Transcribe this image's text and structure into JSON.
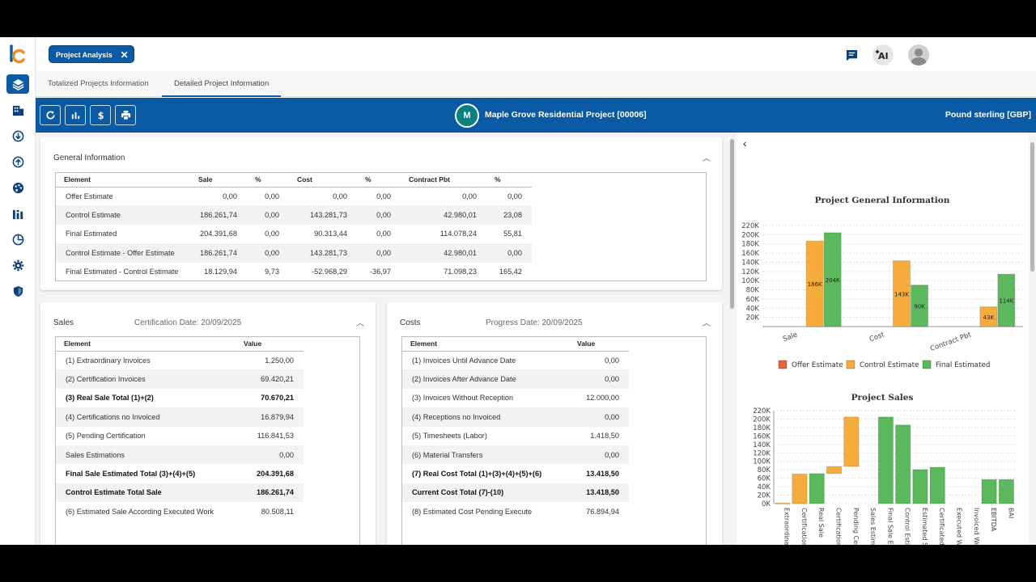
{
  "topbar": {
    "chip_label": "Project Analysis",
    "chip_close": "✕"
  },
  "tabs": [
    {
      "label": "Totalized Projects Information"
    },
    {
      "label": "Detailed Project Information"
    }
  ],
  "header": {
    "avatar_letter": "M",
    "project_title": "Maple Grove Residential Project [00006]",
    "currency": "Pound sterling [GBP]"
  },
  "general": {
    "title": "General Information",
    "columns": [
      "Element",
      "Sale",
      "%",
      "Cost",
      "%",
      "Contract Pbt",
      "%"
    ],
    "rows": [
      [
        "Offer Estimate",
        "0,00",
        "0,00",
        "0,00",
        "0,00",
        "0,00",
        "0,00"
      ],
      [
        "Control Estimate",
        "186.261,74",
        "0,00",
        "143.281,73",
        "0,00",
        "42.980,01",
        "23,08"
      ],
      [
        "Final Estimated",
        "204.391,68",
        "0,00",
        "90.313,44",
        "0,00",
        "114.078,24",
        "55,81"
      ],
      [
        "Control Estimate - Offer Estimate",
        "186.261,74",
        "0,00",
        "143.281,73",
        "0,00",
        "42.980,01",
        "0,00"
      ],
      [
        "Final Estimated - Control Estimate",
        "18.129,94",
        "9,73",
        "-52.968,29",
        "-36,97",
        "71.098,23",
        "165,42"
      ]
    ]
  },
  "sales": {
    "title": "Sales",
    "date_label": "Certification Date: 20/09/2025",
    "columns": [
      "Element",
      "Value"
    ],
    "rows": [
      {
        "label": "(1) Extraordinary Invoices",
        "value": "1.250,00",
        "bold": false
      },
      {
        "label": "(2) Certification Invoices",
        "value": "69.420,21",
        "bold": false
      },
      {
        "label": "(3) Real Sale Total (1)+(2)",
        "value": "70.670,21",
        "bold": true
      },
      {
        "label": "(4) Certifications no Invoiced",
        "value": "16.879,94",
        "bold": false
      },
      {
        "label": "(5) Pending Certification",
        "value": "116.841,53",
        "bold": false
      },
      {
        "label": "Sales Estimations",
        "value": "0,00",
        "bold": false
      },
      {
        "label": "Final Sale Estimated Total (3)+(4)+(5)",
        "value": "204.391,68",
        "bold": true
      },
      {
        "label": "Control Estimate Total Sale",
        "value": "186.261,74",
        "bold": true
      },
      {
        "label": "(6) Estimated Sale According Executed Work",
        "value": "80.508,11",
        "bold": false
      }
    ]
  },
  "costs": {
    "title": "Costs",
    "date_label": "Progress Date: 20/09/2025",
    "columns": [
      "Element",
      "Value"
    ],
    "rows": [
      {
        "label": "(1) Invoices Until Advance Date",
        "value": "0,00",
        "bold": false
      },
      {
        "label": "(2) Invoices After Advance Date",
        "value": "0,00",
        "bold": false
      },
      {
        "label": "(3) Invoices Without Reception",
        "value": "12.000,00",
        "bold": false
      },
      {
        "label": "(4) Receptions no Invoiced",
        "value": "0,00",
        "bold": false
      },
      {
        "label": "(5) Timesheets (Labor)",
        "value": "1.418,50",
        "bold": false
      },
      {
        "label": "(6) Material Transfers",
        "value": "0,00",
        "bold": false
      },
      {
        "label": "(7) Real Cost Total (1)+(3)+(4)+(5)+(6)",
        "value": "13.418,50",
        "bold": true
      },
      {
        "label": "Current Cost Total (7)-(10)",
        "value": "13.418,50",
        "bold": true
      },
      {
        "label": "(8) Estimated Cost Pending Execute",
        "value": "76.894,94",
        "bold": false
      }
    ]
  },
  "colors": {
    "accent": "#0a5aa5",
    "offer": "#e8623a",
    "control": "#f5ac3a",
    "final": "#5cb85c"
  },
  "chart_data": [
    {
      "type": "bar",
      "title": "Project General Information",
      "categories": [
        "Sale",
        "Cost",
        "Contract Pbt"
      ],
      "series": [
        {
          "name": "Offer Estimate",
          "values": [
            0,
            0,
            0
          ],
          "labels": [
            "",
            "",
            ""
          ]
        },
        {
          "name": "Control Estimate",
          "values": [
            186261.74,
            143281.73,
            42980.01
          ],
          "labels": [
            "186K",
            "143K",
            "43K"
          ]
        },
        {
          "name": "Final Estimated",
          "values": [
            204391.68,
            90313.44,
            114078.24
          ],
          "labels": [
            "204K",
            "90K",
            "114K"
          ]
        }
      ],
      "y_ticks": [
        "20K",
        "40K",
        "60K",
        "80K",
        "100K",
        "120K",
        "140K",
        "160K",
        "180K",
        "200K",
        "220K"
      ],
      "ylim": [
        0,
        220000
      ],
      "legend": "bottom",
      "grid": true
    },
    {
      "type": "bar",
      "title": "Project Sales",
      "categories": [
        "Extraordinar",
        "Certification",
        "Real Sale",
        "Certifications",
        "Pending Cert",
        "Sales Estima",
        "Final Sale Es",
        "Control Estin",
        "Estimated Sa",
        "Certificated",
        "Executed Wo",
        "Invoiced Wo",
        "EBITDA",
        "BAI"
      ],
      "bars": [
        {
          "from": 0,
          "to": 1250,
          "series": "control"
        },
        {
          "from": 0,
          "to": 70000,
          "series": "control"
        },
        {
          "from": 0,
          "to": 71000,
          "series": "final"
        },
        {
          "from": 71000,
          "to": 88000,
          "series": "control"
        },
        {
          "from": 88000,
          "to": 205000,
          "series": "control"
        },
        {
          "from": 0,
          "to": 0,
          "series": "control"
        },
        {
          "from": 0,
          "to": 205000,
          "series": "final"
        },
        {
          "from": 0,
          "to": 186000,
          "series": "final"
        },
        {
          "from": 0,
          "to": 80500,
          "series": "final"
        },
        {
          "from": 0,
          "to": 86000,
          "series": "final"
        },
        {
          "from": 0,
          "to": 0,
          "series": "final"
        },
        {
          "from": 0,
          "to": 0,
          "series": "final"
        },
        {
          "from": 0,
          "to": 57000,
          "series": "final"
        },
        {
          "from": 0,
          "to": 57000,
          "series": "final"
        }
      ],
      "y_ticks": [
        "0K",
        "20K",
        "40K",
        "60K",
        "80K",
        "100K",
        "120K",
        "140K",
        "160K",
        "180K",
        "200K",
        "220K"
      ],
      "ylim": [
        0,
        220000
      ],
      "grid": true
    }
  ]
}
